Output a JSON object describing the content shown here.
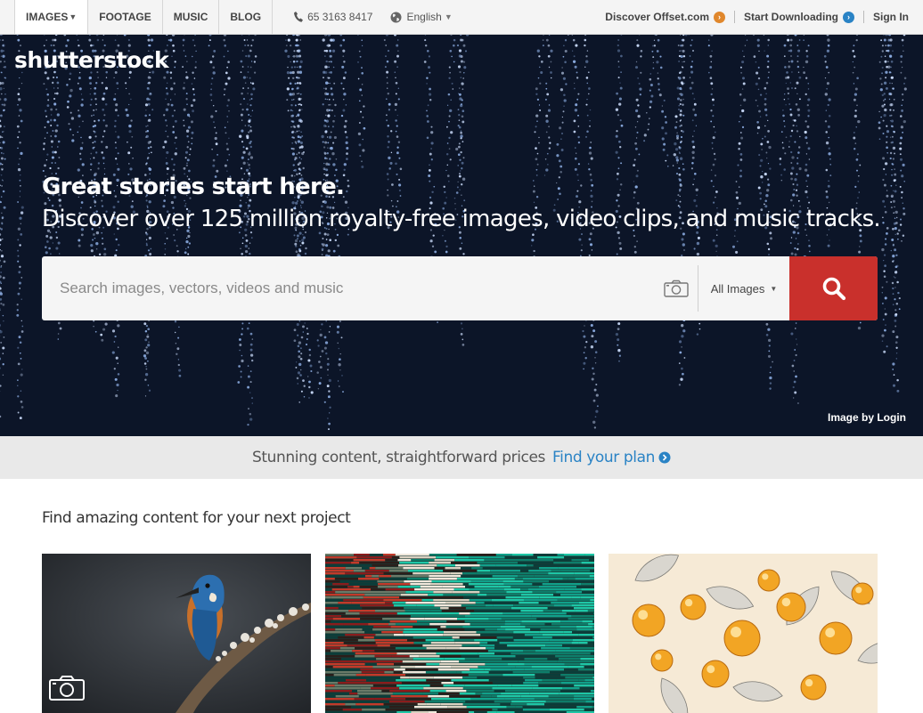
{
  "nav": {
    "tabs": [
      {
        "label": "IMAGES"
      },
      {
        "label": "FOOTAGE"
      },
      {
        "label": "MUSIC"
      },
      {
        "label": "BLOG"
      }
    ],
    "phone": "65 3163 8417",
    "language": "English",
    "offset_label": "Discover Offset.com",
    "start_label": "Start Downloading",
    "signin_label": "Sign In"
  },
  "hero": {
    "logo": "shutterstock",
    "headline_1": "Great stories start here.",
    "headline_2": "Discover over 125 million royalty-free images, video clips, and music tracks.",
    "search_placeholder": "Search images, vectors, videos and music",
    "search_type": "All Images",
    "credit": "Image by Login"
  },
  "pricing": {
    "text": "Stunning content, straightforward prices",
    "link": "Find your plan"
  },
  "content": {
    "title": "Find amazing content for your next project"
  },
  "colors": {
    "search_button": "#c9302c",
    "offset_arrow": "#e0872c",
    "start_arrow": "#2a83c5",
    "link_blue": "#2a83c5"
  }
}
